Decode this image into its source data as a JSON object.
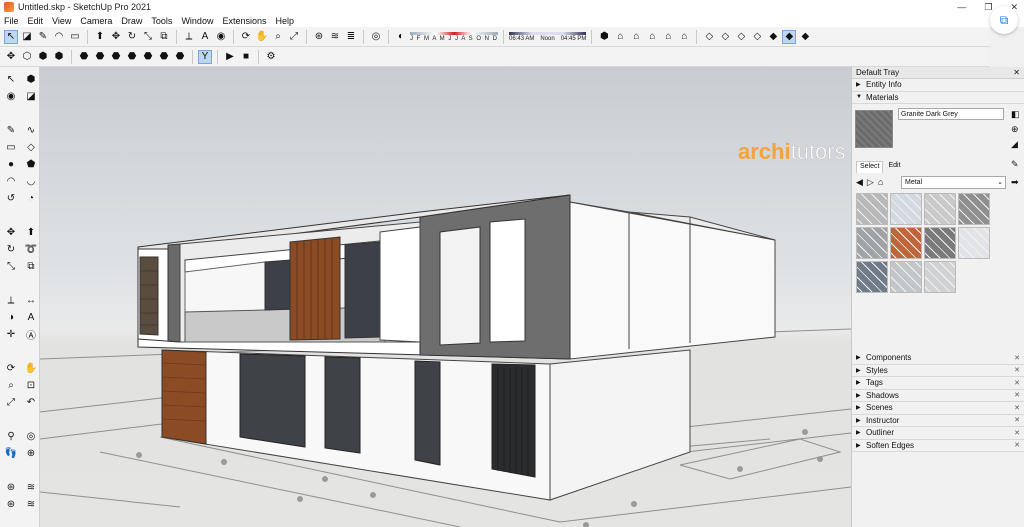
{
  "window": {
    "title": "Untitled.skp - SketchUp Pro 2021",
    "controls": [
      "—",
      "❐",
      "✕"
    ]
  },
  "menu": [
    "File",
    "Edit",
    "View",
    "Camera",
    "Draw",
    "Tools",
    "Window",
    "Extensions",
    "Help"
  ],
  "toolbar": {
    "months": "J F M A M J J A S O N D",
    "time_start": "06:43 AM",
    "time_noon": "Noon",
    "time_end": "04:45 PM"
  },
  "watermark": {
    "part1": "archi",
    "part2": "tutors"
  },
  "tray": {
    "title": "Default Tray",
    "close": "✕",
    "entity_info": "Entity Info",
    "materials": "Materials",
    "material_name": "Granite Dark Grey",
    "tab_select": "Select",
    "tab_edit": "Edit",
    "category": "Metal",
    "sections": [
      "Components",
      "Styles",
      "Tags",
      "Shadows",
      "Scenes",
      "Instructor",
      "Outliner",
      "Soften Edges"
    ]
  },
  "colors": {
    "accent": "#f3a43a",
    "selected": "#bcd7f2",
    "wood": "#8a4b25"
  },
  "swatches": [
    "#b8b8b8",
    "#d3d9e0",
    "#c9c9c9",
    "#8f8f8f",
    "#9fa3a6",
    "#c0643a",
    "#7a7a7a",
    "#e1e3e6",
    "#6f7b88",
    "#c3c6c9",
    "#d0d2d3"
  ]
}
